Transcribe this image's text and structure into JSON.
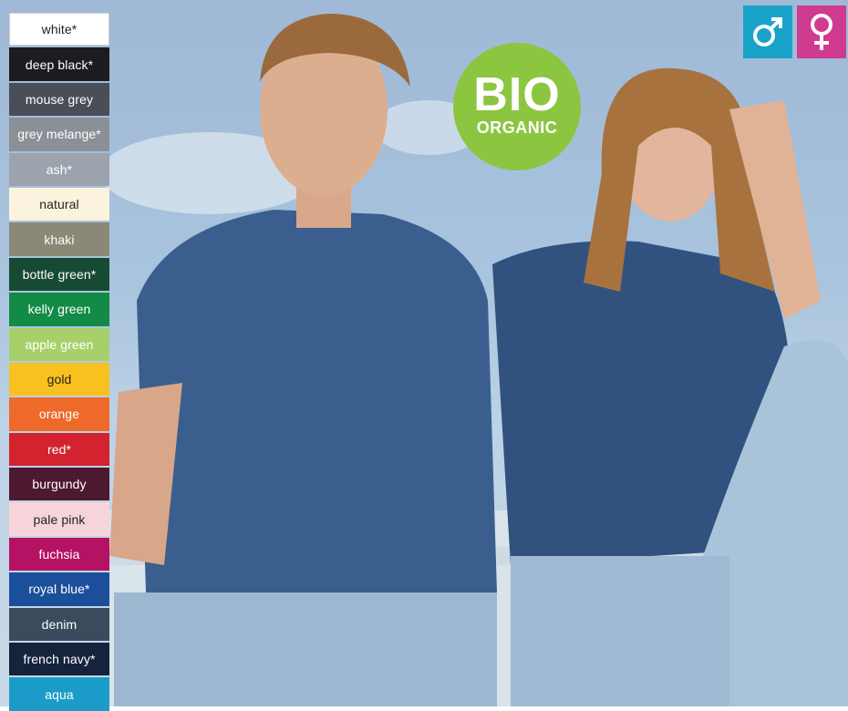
{
  "swatches": [
    {
      "label": "white*",
      "color": "#ffffff",
      "text": "dark"
    },
    {
      "label": "deep black*",
      "color": "#1c1c22",
      "text": "light"
    },
    {
      "label": "mouse grey",
      "color": "#4a4e57",
      "text": "light"
    },
    {
      "label": "grey melange*",
      "color": "#8b8f96",
      "text": "light"
    },
    {
      "label": "ash*",
      "color": "#9ca3ad",
      "text": "light"
    },
    {
      "label": "natural",
      "color": "#fbf3dd",
      "text": "dark"
    },
    {
      "label": "khaki",
      "color": "#8c8878",
      "text": "light"
    },
    {
      "label": "bottle green*",
      "color": "#174a33",
      "text": "light"
    },
    {
      "label": "kelly green",
      "color": "#138b47",
      "text": "light"
    },
    {
      "label": "apple green",
      "color": "#a7d06a",
      "text": "light"
    },
    {
      "label": "gold",
      "color": "#f8c11f",
      "text": "dark"
    },
    {
      "label": "orange",
      "color": "#ee6a2a",
      "text": "light"
    },
    {
      "label": "red*",
      "color": "#d2232f",
      "text": "light"
    },
    {
      "label": "burgundy",
      "color": "#4d1930",
      "text": "light"
    },
    {
      "label": "pale pink",
      "color": "#f7d4da",
      "text": "dark"
    },
    {
      "label": "fuchsia",
      "color": "#b51264",
      "text": "light"
    },
    {
      "label": "royal blue*",
      "color": "#1b4f9b",
      "text": "light"
    },
    {
      "label": "denim",
      "color": "#3b4a5c",
      "text": "light"
    },
    {
      "label": "french navy*",
      "color": "#15233d",
      "text": "light"
    },
    {
      "label": "aqua",
      "color": "#1b9cc8",
      "text": "light"
    }
  ],
  "badge": {
    "big": "BIO",
    "small": "ORGANIC",
    "color": "#8cc540"
  },
  "gender": {
    "male": {
      "icon": "male-symbol-icon",
      "color": "#1aa3c8"
    },
    "female": {
      "icon": "female-symbol-icon",
      "color": "#cf3b8e"
    }
  }
}
